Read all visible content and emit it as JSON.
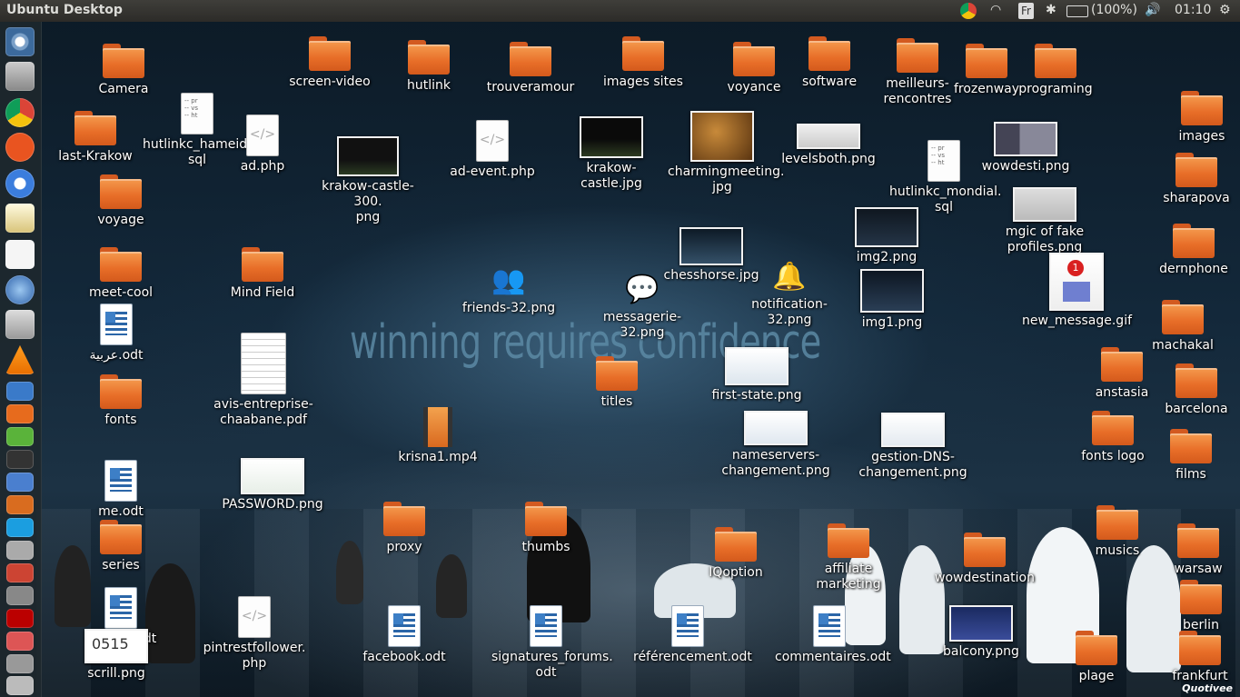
{
  "panel": {
    "title": "Ubuntu Desktop",
    "keyboard": "Fr",
    "battery": "(100%)",
    "clock": "01:10"
  },
  "wallpaper": {
    "motto": "winning requires confidence"
  },
  "watermark": "Quotivee",
  "icons": {
    "camera": "Camera",
    "screen_video": "screen-video",
    "hutlink": "hutlink",
    "trouveramour": "trouveramour",
    "images_sites": "images sites",
    "voyance": "voyance",
    "software": "software",
    "meilleurs_rencontres": "meilleurs-\nrencontres",
    "frozenway": "frozenway",
    "programing": "programing",
    "images": "images",
    "last_krakow": "last-Krakow",
    "hutlinkc_hameida": "hutlinkc_hameida.\nsql",
    "ad_php": "ad.php",
    "krakow_castle_300": "krakow-castle-300.\npng",
    "ad_event": "ad-event.php",
    "krakow_castle": "krakow-castle.jpg",
    "charmingmeeting": "charmingmeeting.\njpg",
    "levelsboth": "levelsboth.png",
    "hutlinkc_mondial": "hutlinkc_mondial.\nsql",
    "wowdesti": "wowdesti.png",
    "sharapova": "sharapova",
    "voyage": "voyage",
    "img2": "img2.png",
    "mgic": "mgic of fake\nprofiles.png",
    "dernphone": "dernphone",
    "meet_cool": "meet-cool",
    "mind_field": "Mind Field",
    "chesshorse": "chesshorse.jpg",
    "friends32": "friends-32.png",
    "messagerie32": "messagerie-32.png",
    "notification32": "notification-32.png",
    "img1": "img1.png",
    "new_message": "new_message.gif",
    "arabic_odt": "عربية.odt",
    "machakal": "machakal",
    "titles": "titles",
    "first_state": "first-state.png",
    "anstasia": "anstasia",
    "barcelona": "barcelona",
    "fonts": "fonts",
    "avis": "avis-entreprise-\nchaabane.pdf",
    "nameservers": "nameservers-\nchangement.png",
    "gestion_dns": "gestion-DNS-\nchangement.png",
    "fonts_logo": "fonts logo",
    "krisna": "krisna1.mp4",
    "films": "films",
    "me_odt": "me.odt",
    "password": "PASSWORD.png",
    "proxy": "proxy",
    "thumbs": "thumbs",
    "iqoption": "IQoption",
    "affiliate": "affiliate marketing",
    "wowdestination": "wowdestination",
    "musics": "musics",
    "warsaw": "warsaw",
    "series": "series",
    "berlin": "berlin",
    "articles": "articles.odt",
    "pintrest": "pintrestfollower.\nphp",
    "facebook": "facebook.odt",
    "signatures": "signatures_forums.\nodt",
    "referencement": "référencement.odt",
    "commentaires": "commentaires.odt",
    "balcony": "balcony.png",
    "scrill": "scrill.png",
    "scrill_digits": "0515",
    "plage": "plage",
    "frankfurt": "frankfurt",
    "badge_count": "1"
  },
  "colors": {
    "folder": "#e86e28",
    "panel": "#3c3b37",
    "accent": "#dd4814"
  }
}
